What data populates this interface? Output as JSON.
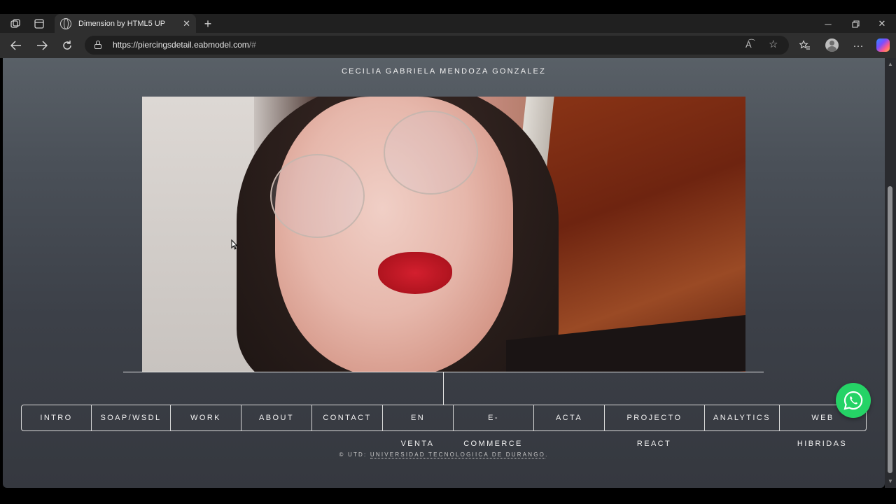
{
  "browser": {
    "tab_title": "Dimension by HTML5 UP",
    "url_host": "https://piercingsdetail.eabmodel.com",
    "url_path": "/#"
  },
  "page": {
    "title": "CECILIA GABRIELA MENDOZA GONZALEZ",
    "nav": [
      {
        "label": "INTRO"
      },
      {
        "label": "SOAP/WSDL"
      },
      {
        "label": "WORK"
      },
      {
        "label": "ABOUT"
      },
      {
        "label": "CONTACT"
      },
      {
        "label": "EN"
      },
      {
        "label": "E-"
      },
      {
        "label": "ACTA"
      },
      {
        "label": "PROJECTO"
      },
      {
        "label": "ANALYTICS"
      },
      {
        "label": "WEB"
      }
    ],
    "nav_overflow": [
      {
        "label": "VENTA"
      },
      {
        "label": "COMMERCE"
      },
      {
        "label": "REACT"
      },
      {
        "label": "HIBRIDAS"
      }
    ],
    "footer_prefix": "© UTD: ",
    "footer_link": "UNIVERSIDAD TECNOLOGIICA DE DURANGO",
    "footer_suffix": "."
  },
  "colors": {
    "whatsapp": "#25d366"
  },
  "icons": [
    "workspaces-icon",
    "tab-actions-icon",
    "globe-icon",
    "close-icon",
    "new-tab-icon",
    "minimize-icon",
    "restore-icon",
    "back-icon",
    "forward-icon",
    "refresh-icon",
    "lock-icon",
    "read-aloud-icon",
    "favorite-star-icon",
    "favorites-icon",
    "profile-icon",
    "more-icon",
    "copilot-icon",
    "whatsapp-icon"
  ]
}
